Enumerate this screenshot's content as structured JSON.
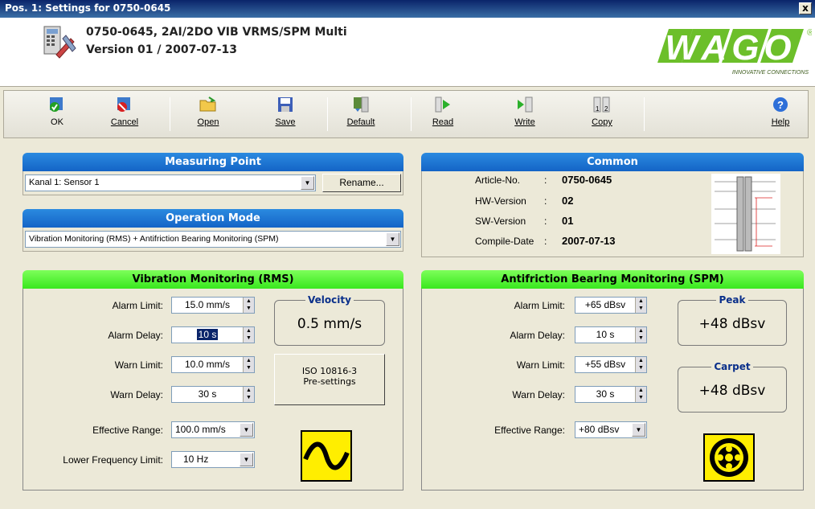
{
  "window": {
    "title": "Pos. 1: Settings for 0750-0645",
    "close": "x"
  },
  "header": {
    "line1": "0750-0645, 2AI/2DO VIB VRMS/SPM Multi",
    "line2": "Version 01 / 2007-07-13",
    "logo_text": "WAGO",
    "logo_tagline": "INNOVATIVE CONNECTIONS",
    "logo_reg": "®"
  },
  "toolbar": {
    "ok": "OK",
    "cancel": "Cancel",
    "open": "Open",
    "save": "Save",
    "default": "Default",
    "read": "Read",
    "write": "Write",
    "copy": "Copy",
    "help": "Help"
  },
  "measuring_point": {
    "title": "Measuring Point",
    "value": "Kanal 1: Sensor 1",
    "rename": "Rename..."
  },
  "operation_mode": {
    "title": "Operation Mode",
    "value": "Vibration Monitoring (RMS) + Antifriction Bearing Monitoring (SPM)"
  },
  "common": {
    "title": "Common",
    "rows": [
      {
        "label": "Article-No.",
        "sep": ":",
        "value": "0750-0645"
      },
      {
        "label": "HW-Version",
        "sep": ":",
        "value": "02"
      },
      {
        "label": "SW-Version",
        "sep": ":",
        "value": "01"
      },
      {
        "label": "Compile-Date",
        "sep": ":",
        "value": "2007-07-13"
      }
    ]
  },
  "rms": {
    "title": "Vibration Monitoring (RMS)",
    "alarm_limit_label": "Alarm Limit:",
    "alarm_limit": "15.0 mm/s",
    "alarm_delay_label": "Alarm Delay:",
    "alarm_delay": "10 s",
    "warn_limit_label": "Warn Limit:",
    "warn_limit": "10.0 mm/s",
    "warn_delay_label": "Warn Delay:",
    "warn_delay": "30 s",
    "eff_range_label": "Effective Range:",
    "eff_range": "100.0 mm/s",
    "low_freq_label": "Lower Frequency Limit:",
    "low_freq": "10 Hz",
    "velocity_title": "Velocity",
    "velocity_value": "0.5 mm/s",
    "iso_line1": "ISO 10816-3",
    "iso_line2": "Pre-settings"
  },
  "spm": {
    "title": "Antifriction Bearing Monitoring (SPM)",
    "alarm_limit_label": "Alarm Limit:",
    "alarm_limit": "+65 dBsv",
    "alarm_delay_label": "Alarm Delay:",
    "alarm_delay": "10 s",
    "warn_limit_label": "Warn Limit:",
    "warn_limit": "+55 dBsv",
    "warn_delay_label": "Warn Delay:",
    "warn_delay": "30 s",
    "eff_range_label": "Effective Range:",
    "eff_range": "+80 dBsv",
    "peak_title": "Peak",
    "peak_value": "+48 dBsv",
    "carpet_title": "Carpet",
    "carpet_value": "+48 dBsv"
  },
  "colors": {
    "blue_header": "#1464c6",
    "green_header": "#38e81e",
    "wago_green": "#6cbf2a",
    "signal_yellow": "#ffee00"
  }
}
